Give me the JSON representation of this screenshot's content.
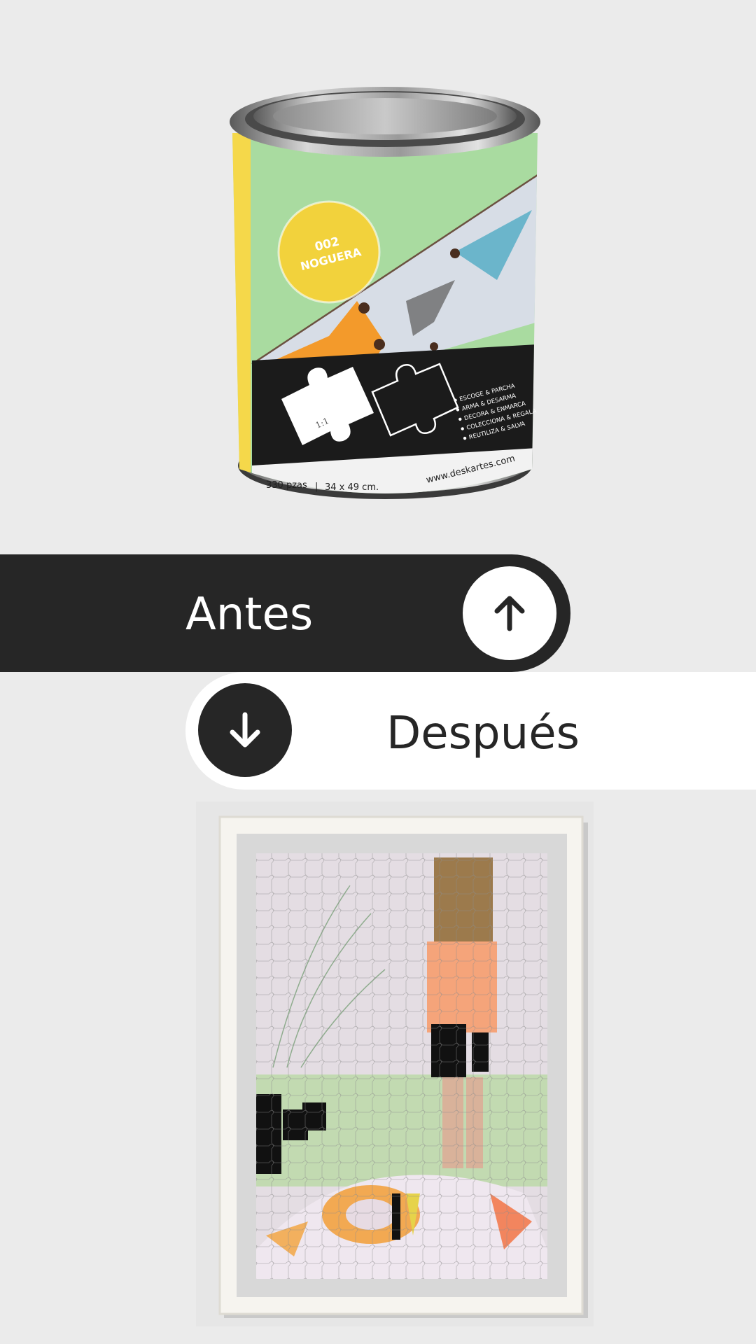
{
  "product": {
    "badge_number": "002",
    "badge_name": "NOGUERA",
    "piece_label": "1:1",
    "features": [
      "ESCOGE & PARCHA",
      "ARMA & DESARMA",
      "DECORA & ENMARCA",
      "COLECCIONA & REGALA",
      "REUTILIZA & SALVA"
    ],
    "pieces": "330 pzas",
    "separator": "|",
    "size": "34 x 49 cm.",
    "website": "www.deskartes.com"
  },
  "toggle": {
    "before_label": "Antes",
    "after_label": "Después"
  },
  "icons": {
    "before": "arrow-up-icon",
    "after": "arrow-down-icon"
  },
  "colors": {
    "dark": "#262626",
    "light": "#ffffff",
    "background": "#ebebeb",
    "can_yellow": "#f5d84a",
    "badge_yellow": "#f2d23c"
  }
}
